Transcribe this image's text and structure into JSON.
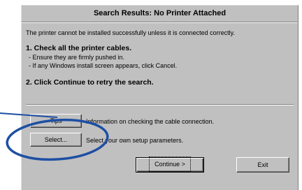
{
  "dialog": {
    "title": "Search Results: No Printer Attached",
    "intro": "The printer cannot be installed successfully unless it is connected correctly.",
    "step1": {
      "heading": "1. Check all the printer cables.",
      "bullets": [
        "- Ensure they are firmly pushed in.",
        "- If any Windows install screen appears, click Cancel."
      ]
    },
    "step2": {
      "heading": "2. Click Continue to retry the search."
    },
    "options": [
      {
        "button": "Tips",
        "description": "Information on checking the cable connection."
      },
      {
        "button": "Select...",
        "description": "Select your own setup parameters."
      }
    ],
    "continue_label": "Continue >",
    "exit_label": "Exit"
  },
  "annotation": {
    "color": "#1e4fa3"
  }
}
